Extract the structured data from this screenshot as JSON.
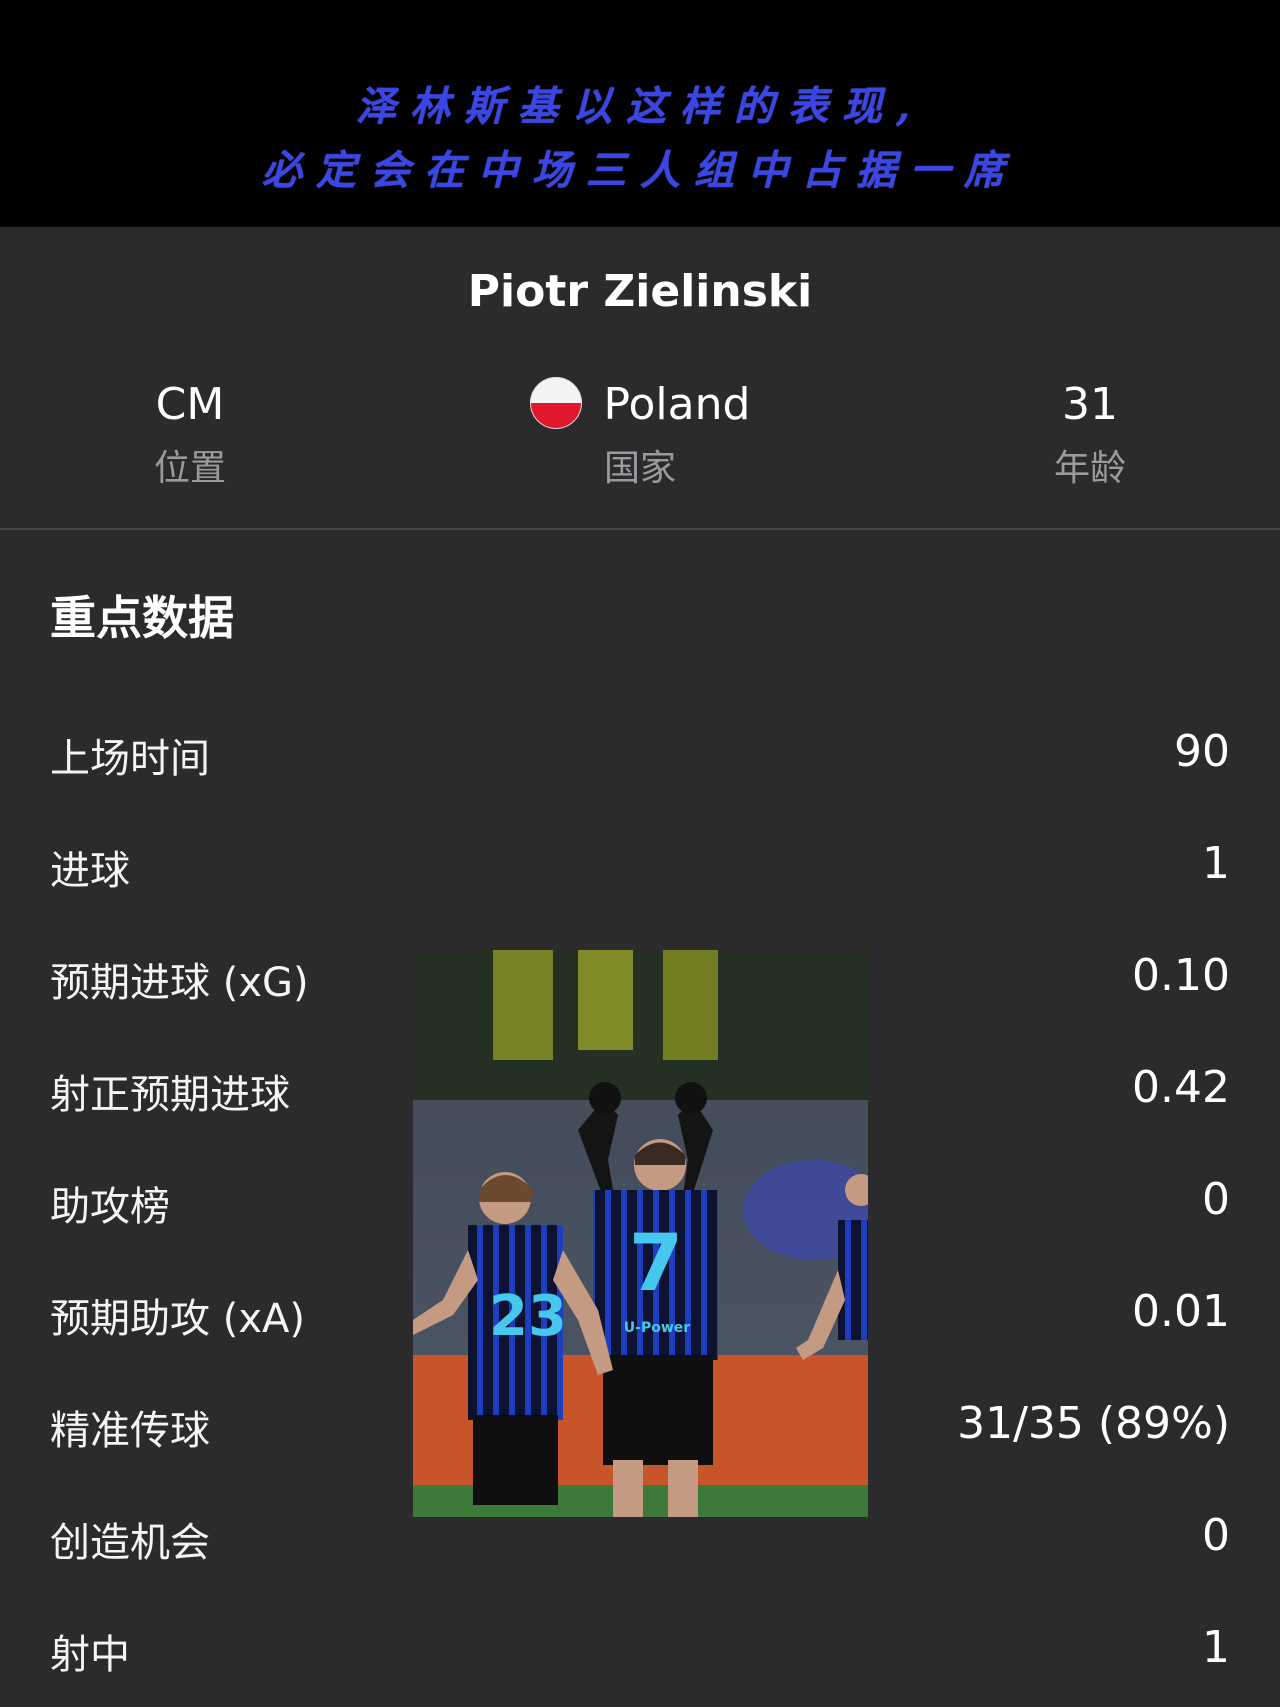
{
  "banner": {
    "line1": "泽林斯基以这样的表现,",
    "line2": "必定会在中场三人组中占据一席",
    "text_color": "#3a46e6"
  },
  "player": {
    "name": "Piotr Zielinski",
    "position": {
      "value": "CM",
      "label": "位置"
    },
    "country": {
      "value": "Poland",
      "label": "国家",
      "flag_colors": [
        "#f4f4f4",
        "#e1192f"
      ]
    },
    "age": {
      "value": "31",
      "label": "年龄"
    }
  },
  "section_title": "重点数据",
  "stats": [
    {
      "label": "上场时间",
      "value": "90"
    },
    {
      "label": "进球",
      "value": "1"
    },
    {
      "label": "预期进球 (xG)",
      "value": "0.10"
    },
    {
      "label": "射正预期进球",
      "value": "0.42"
    },
    {
      "label": "助攻榜",
      "value": "0"
    },
    {
      "label": "预期助攻 (xA)",
      "value": "0.01"
    },
    {
      "label": "精准传球",
      "value": "31/35 (89%)"
    },
    {
      "label": "创造机会",
      "value": "0"
    },
    {
      "label": "射中",
      "value": "1"
    }
  ],
  "photo": {
    "jersey_numbers": [
      "7",
      "23"
    ],
    "sponsor_text": "U-Power"
  },
  "colors": {
    "background": "#2b2b2d",
    "banner_background": "#000000",
    "label_gray": "#9b9b9e",
    "divider": "#474749"
  }
}
